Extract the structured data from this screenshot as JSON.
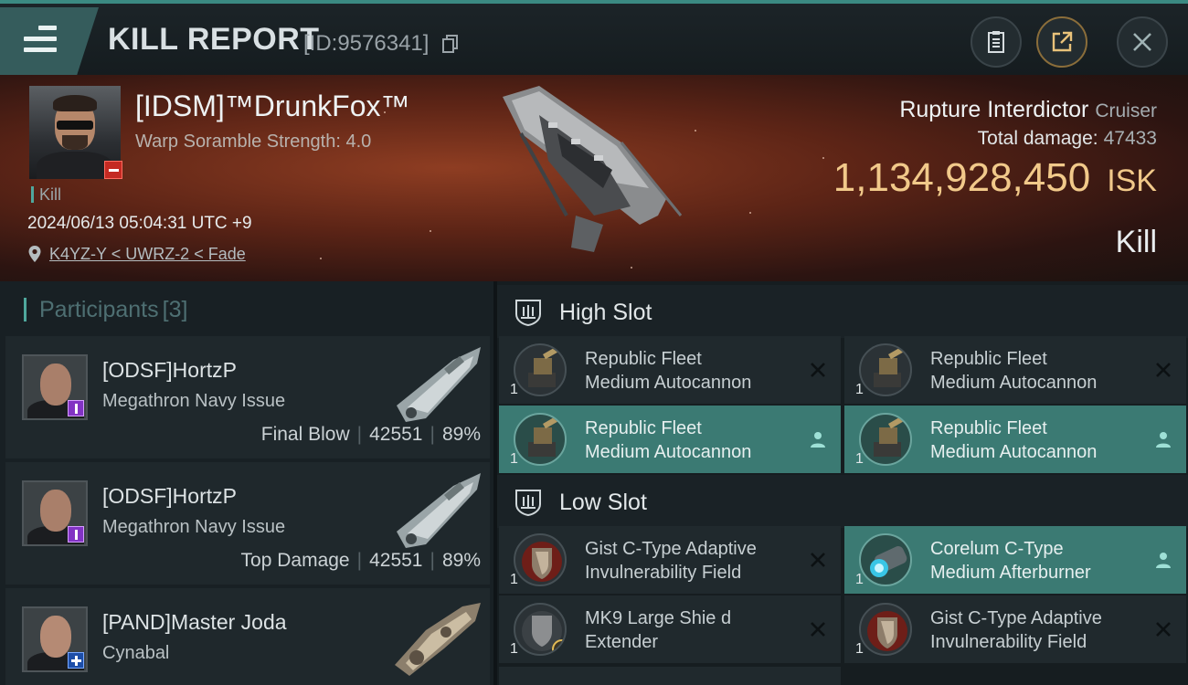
{
  "header": {
    "title": "KILL REPORT",
    "report_id": "[ID:9576341]"
  },
  "victim": {
    "name": "[IDSM]™DrunkFox™",
    "subtitle": "Warp Soramble Strength: 4.0",
    "tag": "Kill",
    "datetime": "2024/06/13 05:04:31 UTC +9",
    "location": "K4YZ-Y < UWRZ-2 < Fade",
    "ship": "Rupture Interdictor",
    "ship_class": "Cruiser",
    "total_damage_label": "Total damage:",
    "total_damage": "47433",
    "isk_value": "1,134,928,450",
    "isk_unit": "ISK",
    "result": "Kill"
  },
  "participants": {
    "title": "Participants",
    "count": "[3]",
    "items": [
      {
        "name": "[ODSF]HortzP",
        "ship": "Megathron Navy Issue",
        "role": "Final Blow",
        "damage": "42551",
        "percent": "89%"
      },
      {
        "name": "[ODSF]HortzP",
        "ship": "Megathron Navy Issue",
        "role": "Top Damage",
        "damage": "42551",
        "percent": "89%"
      },
      {
        "name": "[PAND]Master Joda",
        "ship": "Cynabal"
      }
    ]
  },
  "fitting": {
    "high_slot": {
      "title": "High Slot",
      "modules": [
        {
          "line1": "Republic Fleet",
          "line2": "Medium Autocannon",
          "qty": "1",
          "status": "destroyed"
        },
        {
          "line1": "Republic Fleet",
          "line2": "Medium Autocannon",
          "qty": "1",
          "status": "destroyed"
        },
        {
          "line1": "Republic Fleet",
          "line2": "Medium Autocannon",
          "qty": "1",
          "status": "dropped"
        },
        {
          "line1": "Republic Fleet",
          "line2": "Medium Autocannon",
          "qty": "1",
          "status": "dropped"
        }
      ]
    },
    "low_slot": {
      "title": "Low Slot",
      "modules": [
        {
          "line1": "Gist C-Type Adaptive",
          "line2": "Invulnerability Field",
          "qty": "1",
          "status": "destroyed"
        },
        {
          "line1": "Corelum C-Type",
          "line2": "Medium Afterburner",
          "qty": "1",
          "status": "dropped"
        },
        {
          "line1": "MK9 Large Shie d",
          "line2": "Extender",
          "qty": "1",
          "status": "destroyed"
        },
        {
          "line1": "Gist C-Type Adaptive",
          "line2": "Invulnerability Field",
          "qty": "1",
          "status": "destroyed"
        }
      ]
    }
  },
  "colors": {
    "accent": "#4fa89d",
    "dropped_bg": "#3b7a73",
    "isk": "#f1c98a",
    "header_stripe": "#3b8a82"
  }
}
